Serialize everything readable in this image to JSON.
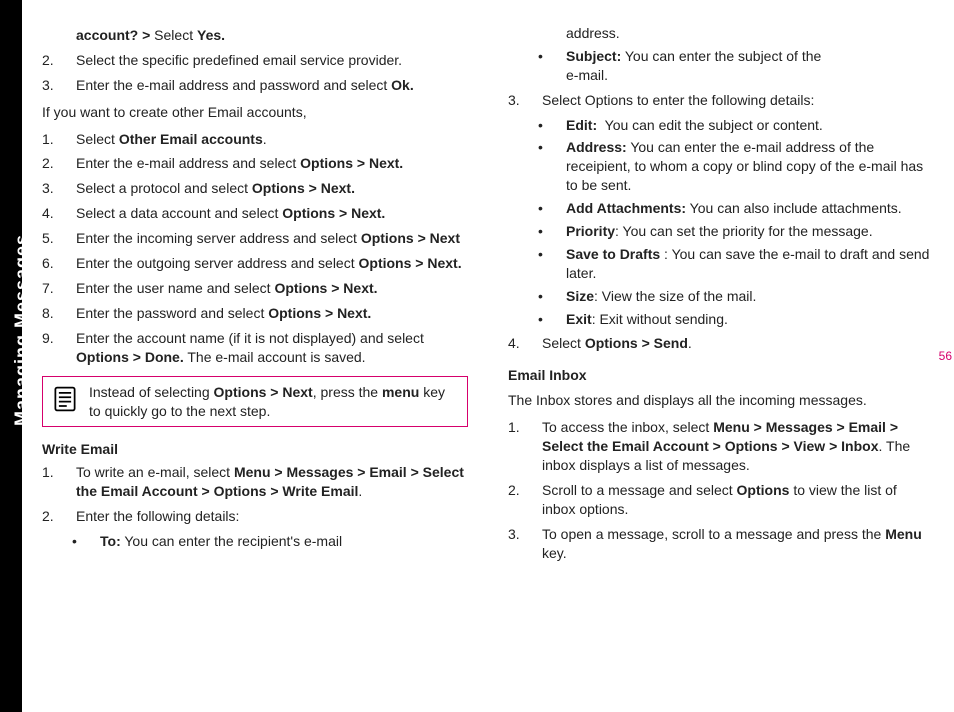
{
  "sidebar": {
    "label": "Managing Messages"
  },
  "pageno": "56",
  "left": {
    "p0": "account? > Select Yes.",
    "l2": "Select the specific predefined email service provider.",
    "l3": "Enter the e-mail address and password and select Ok.",
    "p1": "If you want to create other Email accounts,",
    "o1": "Select Other Email accounts.",
    "o2": "Enter the e-mail address and select Options > Next.",
    "o3": "Select a protocol and select Options > Next.",
    "o4": "Select a data account and select Options > Next.",
    "o5": "Enter the incoming server address and select Options > Next",
    "o6": "Enter the outgoing server address and select Options > Next.",
    "o7": "Enter the user name and select Options > Next.",
    "o8": "Enter the password and select Options > Next.",
    "o9": "Enter the account name (if it is not displayed) and select Options > Done. The e-mail account is saved.",
    "note": "Instead of selecting Options > Next, press the menu key to quickly go to the next step.",
    "sect1": "Write Email",
    "w1": "To write an e-mail, select Menu > Messages > Email > Select the Email Account > Options > Write Email.",
    "w2": "Enter the following details:",
    "w2a": "To: You can enter the recipient's e-mail"
  },
  "right": {
    "cont1": "address.",
    "b1": "Subject: You can enter the subject of the e-mail.",
    "l3": "Select Options to enter the following details:",
    "d1": "Edit:  You can edit the subject or content.",
    "d2": "Address: You can enter the e-mail address of the receipient, to whom a copy or blind copy of the e-mail has to be sent.",
    "d3": "Add Attachments: You can also include attachments.",
    "d4": "Priority: You can set the priority for the message.",
    "d5": "Save to Drafts : You can save the e-mail to draft and send later.",
    "d6": "Size: View the size of the mail.",
    "d7": "Exit: Exit without sending.",
    "l4": "Select Options > Send.",
    "sect2": "Email Inbox",
    "p2": "The Inbox stores and displays all the incoming messages.",
    "i1": "To access the inbox, select Menu > Messages > Email > Select the Email Account > Options > View > Inbox. The inbox displays a list of messages.",
    "i2": "Scroll to a message and select Options to view the list of inbox options.",
    "i3": "To open a message, scroll to a message and press the Menu key."
  }
}
